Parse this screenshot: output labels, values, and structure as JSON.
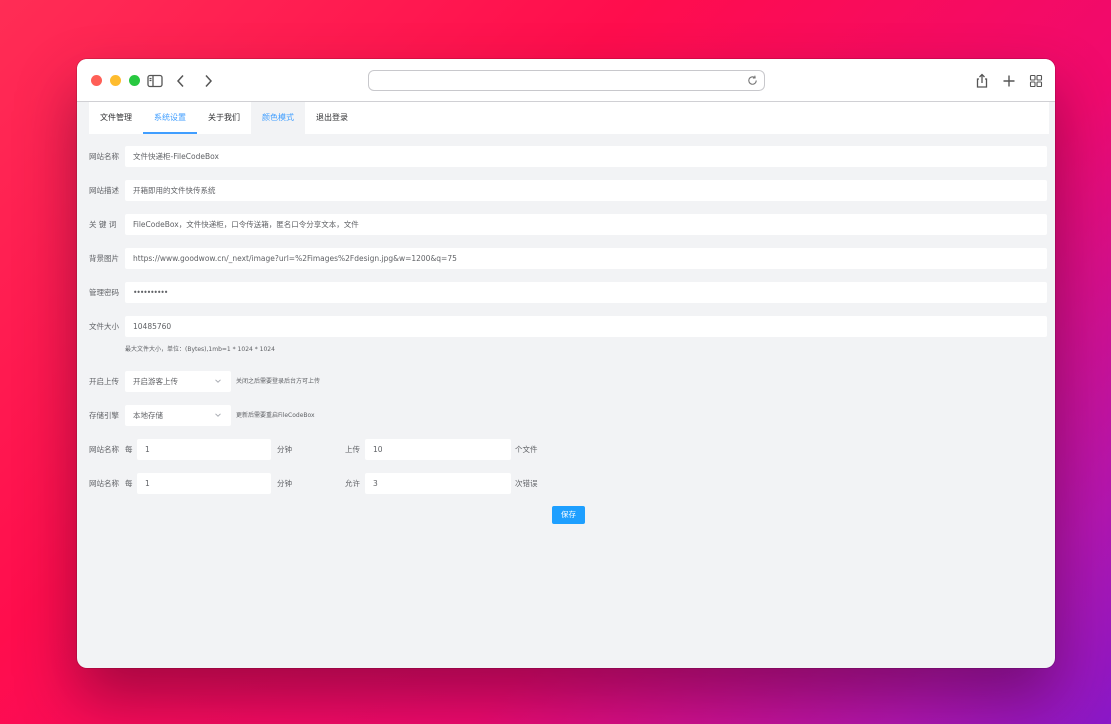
{
  "colors": {
    "accent": "#409eff",
    "button": "#1e9fff",
    "close": "#ff5f57",
    "minimize": "#febc2e",
    "zoom": "#28c840"
  },
  "browser": {
    "address_value": ""
  },
  "tabs": [
    {
      "label": "文件管理"
    },
    {
      "label": "系统设置"
    },
    {
      "label": "关于我们"
    },
    {
      "label": "颜色模式"
    },
    {
      "label": "退出登录"
    }
  ],
  "form": {
    "site_name": {
      "label": "网站名称",
      "value": "文件快递柜-FileCodeBox"
    },
    "site_desc": {
      "label": "网站描述",
      "value": "开箱即用的文件快传系统"
    },
    "keywords": {
      "label": "关 键 词",
      "value": "FileCodeBox，文件快递柜，口令传送箱，匿名口令分享文本，文件"
    },
    "background": {
      "label": "背景图片",
      "value": "https://www.goodwow.cn/_next/image?url=%2Fimages%2Fdesign.jpg&w=1200&q=75"
    },
    "admin_password": {
      "label": "管理密码",
      "value": "••••••••••"
    },
    "file_size": {
      "label": "文件大小",
      "value": "10485760",
      "hint": "最大文件大小，单位：(Bytes),1mb=1 * 1024 * 1024"
    },
    "upload_open": {
      "label": "开启上传",
      "value": "开启游客上传",
      "hint": "关闭之后需要登录后台方可上传"
    },
    "storage": {
      "label": "存储引擎",
      "value": "本地存储",
      "hint": "更新后需要重启FileCodeBox"
    },
    "rate_upload": {
      "label": "网站名称",
      "every": "每",
      "minutes": "1",
      "minute_unit": "分钟",
      "action": "上传",
      "count": "10",
      "count_unit": "个文件"
    },
    "rate_error": {
      "label": "网站名称",
      "every": "每",
      "minutes": "1",
      "minute_unit": "分钟",
      "action": "允许",
      "count": "3",
      "count_unit": "次错误"
    }
  },
  "save_label": "保存"
}
